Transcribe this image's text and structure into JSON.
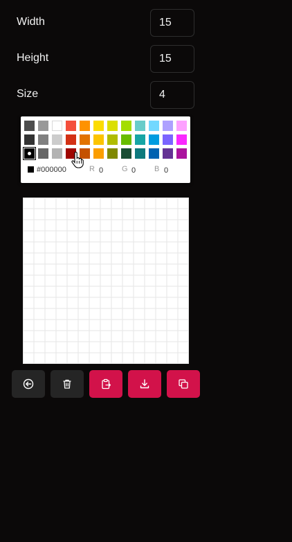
{
  "settings": {
    "width_label": "Width",
    "width_value": "15",
    "height_label": "Height",
    "height_value": "15",
    "size_label": "Size",
    "size_value": "4"
  },
  "picker": {
    "rows": [
      [
        "#4d4d4d",
        "#999999",
        "#ffffff",
        "#f44e3b",
        "#fe9200",
        "#fcdc00",
        "#dbdf00",
        "#a4dd00",
        "#68ccca",
        "#73d8ff",
        "#aea1ff",
        "#fda1ff"
      ],
      [
        "#333333",
        "#808080",
        "#cccccc",
        "#d33115",
        "#e27300",
        "#fcc400",
        "#b0bc00",
        "#68bc00",
        "#16a5a5",
        "#009ce0",
        "#7b64ff",
        "#fa28ff"
      ],
      [
        "#000000",
        "#666666",
        "#b3b3b3",
        "#9f0500",
        "#c45100",
        "#fb9e00",
        "#808900",
        "#194d33",
        "#0c797d",
        "#0062b1",
        "#653294",
        "#ab149e"
      ]
    ],
    "selected": "#000000",
    "hex": "#000000",
    "r_label": "R",
    "r_value": "0",
    "g_label": "G",
    "g_value": "0",
    "b_label": "B",
    "b_value": "0"
  },
  "canvas": {
    "columns": 15,
    "rows": 15,
    "grid_color": "#e6e6e6",
    "fill": "#ffffff"
  },
  "toolbar": {
    "buttons": [
      {
        "name": "undo-button",
        "icon": "back-arrow-icon",
        "style": "dark"
      },
      {
        "name": "clear-button",
        "icon": "trash-icon",
        "style": "dark"
      },
      {
        "name": "paste-button",
        "icon": "clipboard-icon",
        "style": "pink"
      },
      {
        "name": "download-button",
        "icon": "download-icon",
        "style": "pink"
      },
      {
        "name": "copy-button",
        "icon": "copy-icon",
        "style": "pink"
      }
    ]
  },
  "colors": {
    "background": "#0b0909",
    "accent": "#d2124a",
    "dark_button": "#252525"
  }
}
